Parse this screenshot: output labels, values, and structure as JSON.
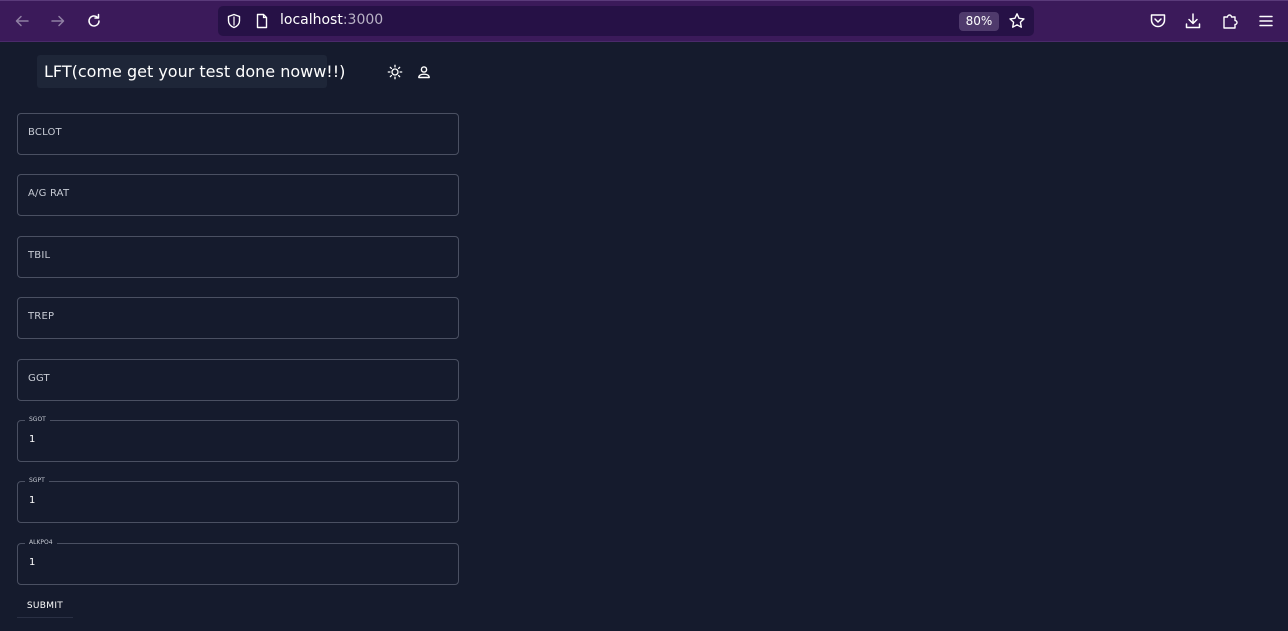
{
  "browser": {
    "url_host": "localhost",
    "url_port": ":3000",
    "zoom": "80%"
  },
  "app": {
    "title": "LFT(come get your test done noww!!)"
  },
  "form": {
    "fields": [
      {
        "placeholder": "BCLOT"
      },
      {
        "placeholder": "A/G RAT"
      },
      {
        "placeholder": "TBIL"
      },
      {
        "placeholder": "TREP"
      },
      {
        "placeholder": "GGT"
      },
      {
        "label": "SGOT",
        "value": "1"
      },
      {
        "label": "SGPT",
        "value": "1"
      },
      {
        "label": "ALKPO4",
        "value": "1"
      }
    ],
    "submit_label": "SUBMIT"
  },
  "icons": {
    "back": "back-arrow-icon",
    "forward": "forward-arrow-icon",
    "reload": "reload-icon",
    "shield": "tracking-protection-shield-icon",
    "page": "page-info-icon",
    "star": "bookmark-star-icon",
    "pocket": "pocket-icon",
    "downloads": "download-icon",
    "extensions": "extensions-puzzle-icon",
    "menu": "hamburger-menu-icon",
    "theme": "sun-icon",
    "account": "person-icon"
  },
  "colors": {
    "chrome_bg": "#3b1a5a",
    "urlbar_bg": "#261146",
    "page_bg": "#151b2d",
    "title_bg": "#1e2638",
    "field_border": "#4a5062"
  }
}
